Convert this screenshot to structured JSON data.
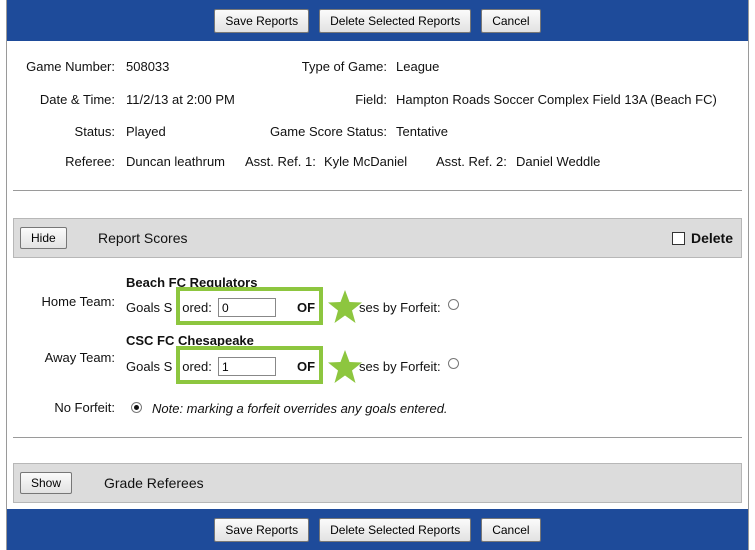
{
  "toolbar": {
    "save_label": "Save Reports",
    "delete_label": "Delete Selected Reports",
    "cancel_label": "Cancel"
  },
  "game": {
    "number_label": "Game Number:",
    "number": "508033",
    "type_label": "Type of Game:",
    "type": "League",
    "datetime_label": "Date & Time:",
    "datetime": "11/2/13 at 2:00 PM",
    "field_label": "Field:",
    "field": "Hampton Roads Soccer Complex Field 13A (Beach FC)",
    "status_label": "Status:",
    "status": "Played",
    "score_status_label": "Game Score Status:",
    "score_status": "Tentative",
    "referee_label": "Referee:",
    "referee": "Duncan leathrum",
    "asst1_label": "Asst. Ref. 1:",
    "asst1": "Kyle McDaniel",
    "asst2_label": "Asst. Ref. 2:",
    "asst2": "Daniel Weddle"
  },
  "report_scores": {
    "toggle_label": "Hide",
    "title": "Report Scores",
    "delete_label": "Delete",
    "home_label": "Home Team:",
    "home_name": "Beach FC Regulators",
    "home_goals": "0",
    "away_label": "Away Team:",
    "away_name": "CSC FC Chesapeake",
    "away_goals": "1",
    "goals_prefix": "Goals S",
    "goals_suffix": "ored:",
    "or_text": "OF",
    "forfeit_text": "ses by Forfeit:",
    "no_forfeit_label": "No Forfeit:",
    "note": "Note: marking a forfeit overrides any goals entered."
  },
  "grade_referees": {
    "toggle_label": "Show",
    "title": "Grade Referees"
  },
  "colors": {
    "header_bar": "#1e4b9a",
    "highlight": "#8dc63f",
    "section_bg": "#dcdcdc"
  }
}
